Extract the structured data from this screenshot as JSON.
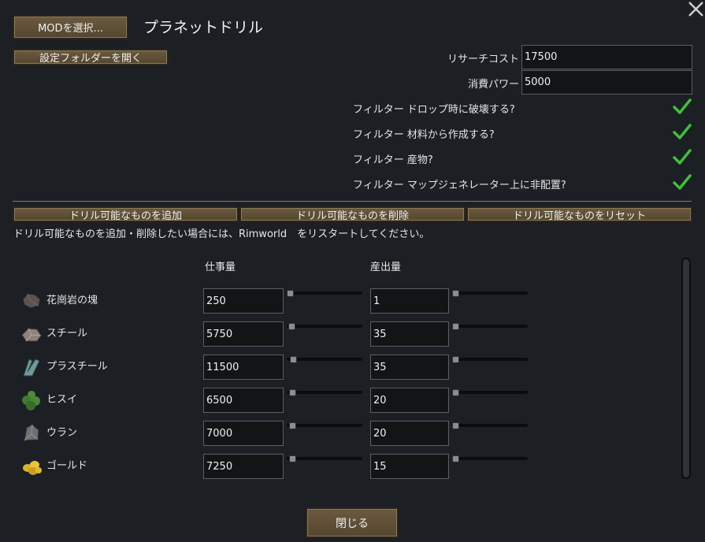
{
  "window": {
    "title": "プラネットドリル",
    "close_glyph": "✕"
  },
  "top_buttons": {
    "select_mod": "MODを選択...",
    "open_settings_folder": "設定フォルダーを開く"
  },
  "settings": {
    "research_cost_label": "リサーチコスト",
    "research_cost_value": "17500",
    "power_consumption_label": "消費パワー",
    "power_consumption_value": "5000",
    "checkboxes": [
      {
        "label": "フィルター ドロップ時に破壊する?",
        "checked": true
      },
      {
        "label": "フィルター 材料から作成する?",
        "checked": true
      },
      {
        "label": "フィルター 産物?",
        "checked": true
      },
      {
        "label": "フィルター マップジェネレーター上に非配置?",
        "checked": true
      }
    ]
  },
  "action_buttons": {
    "add": "ドリル可能なものを追加",
    "remove": "ドリル可能なものを削除",
    "reset": "ドリル可能なものをリセット"
  },
  "info_text": "ドリル可能なものを追加・削除したい場合には、Rimworld　をリスタートしてください。",
  "table": {
    "col_work": "仕事量",
    "col_output": "産出量",
    "rows": [
      {
        "name": "花崗岩の塊",
        "icon": "granite-chunk-icon",
        "work": "250",
        "output": "1",
        "work_level": 0.0,
        "output_level": 0.0
      },
      {
        "name": "スチール",
        "icon": "steel-icon",
        "work": "5750",
        "output": "35",
        "work_level": 0.025,
        "output_level": 0.0
      },
      {
        "name": "プラスチール",
        "icon": "plasteel-icon",
        "work": "11500",
        "output": "35",
        "work_level": 0.05,
        "output_level": 0.0
      },
      {
        "name": "ヒスイ",
        "icon": "jade-icon",
        "work": "6500",
        "output": "20",
        "work_level": 0.03,
        "output_level": 0.0
      },
      {
        "name": "ウラン",
        "icon": "uranium-icon",
        "work": "7000",
        "output": "20",
        "work_level": 0.03,
        "output_level": 0.0
      },
      {
        "name": "ゴールド",
        "icon": "gold-icon",
        "work": "7250",
        "output": "15",
        "work_level": 0.03,
        "output_level": 0.0
      }
    ]
  },
  "close_button": "閉じる",
  "colors": {
    "background": "#1c1f23",
    "button": "#5f5037",
    "check": "#3fbf3a"
  }
}
